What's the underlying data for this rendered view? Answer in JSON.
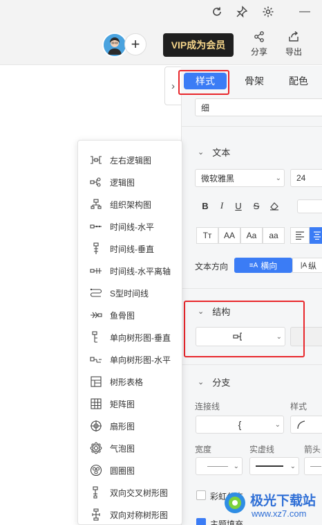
{
  "window_controls": {
    "refresh": "refresh-icon",
    "pin": "pin-icon",
    "settings": "gear-icon",
    "minimize": "—"
  },
  "toolbar": {
    "vip_label": "VIP成为会员",
    "share_label": "分享",
    "export_label": "导出",
    "plus": "+",
    "colors": {
      "vip_bg": "#1f1f1f",
      "vip_text": "#f5d58a"
    }
  },
  "panel_toggle": "›",
  "tabs": [
    {
      "label": "样式",
      "active": true
    },
    {
      "label": "骨架",
      "active": false
    },
    {
      "label": "配色",
      "active": false
    }
  ],
  "style_panel": {
    "line_weight_value": "细",
    "text_section": {
      "title": "文本",
      "font_family": "微软雅黑",
      "font_size": "24",
      "format_buttons": [
        "B",
        "I",
        "U",
        "S"
      ],
      "case_buttons": [
        "Tт",
        "AA",
        "Aa",
        "aa"
      ],
      "direction_label": "文本方向",
      "direction_active": "横向",
      "direction_other": "纵"
    },
    "structure_section": {
      "title": "结构"
    },
    "branch_section": {
      "title": "分支",
      "connector_label": "连接线",
      "style_label": "样式",
      "width_label": "宽度",
      "solid_label": "实虚线",
      "arrow_label": "箭头",
      "rainbow_label": "彩虹分支",
      "theme_fill_label": "主题填充"
    }
  },
  "structure_menu": [
    {
      "label": "左右逻辑图",
      "icon": "left-right-logic-icon"
    },
    {
      "label": "逻辑图",
      "icon": "logic-icon"
    },
    {
      "label": "组织架构图",
      "icon": "org-chart-icon"
    },
    {
      "label": "时间线-水平",
      "icon": "timeline-horizontal-icon"
    },
    {
      "label": "时间线-垂直",
      "icon": "timeline-vertical-icon"
    },
    {
      "label": "时间线-水平离轴",
      "icon": "timeline-offaxis-icon"
    },
    {
      "label": "S型时间线",
      "icon": "s-timeline-icon"
    },
    {
      "label": "鱼骨图",
      "icon": "fishbone-icon"
    },
    {
      "label": "单向树形图-垂直",
      "icon": "tree-vertical-icon"
    },
    {
      "label": "单向树形图-水平",
      "icon": "tree-horizontal-icon"
    },
    {
      "label": "树形表格",
      "icon": "tree-table-icon"
    },
    {
      "label": "矩阵图",
      "icon": "matrix-icon"
    },
    {
      "label": "扇形图",
      "icon": "fan-icon"
    },
    {
      "label": "气泡图",
      "icon": "bubble-icon"
    },
    {
      "label": "圆圈图",
      "icon": "circle-icon"
    },
    {
      "label": "双向交叉树形图",
      "icon": "cross-tree-icon"
    },
    {
      "label": "双向对称树形图",
      "icon": "symmetric-tree-icon"
    }
  ],
  "watermark": {
    "brand": "极光下载站",
    "url": "www.xz7.com"
  }
}
